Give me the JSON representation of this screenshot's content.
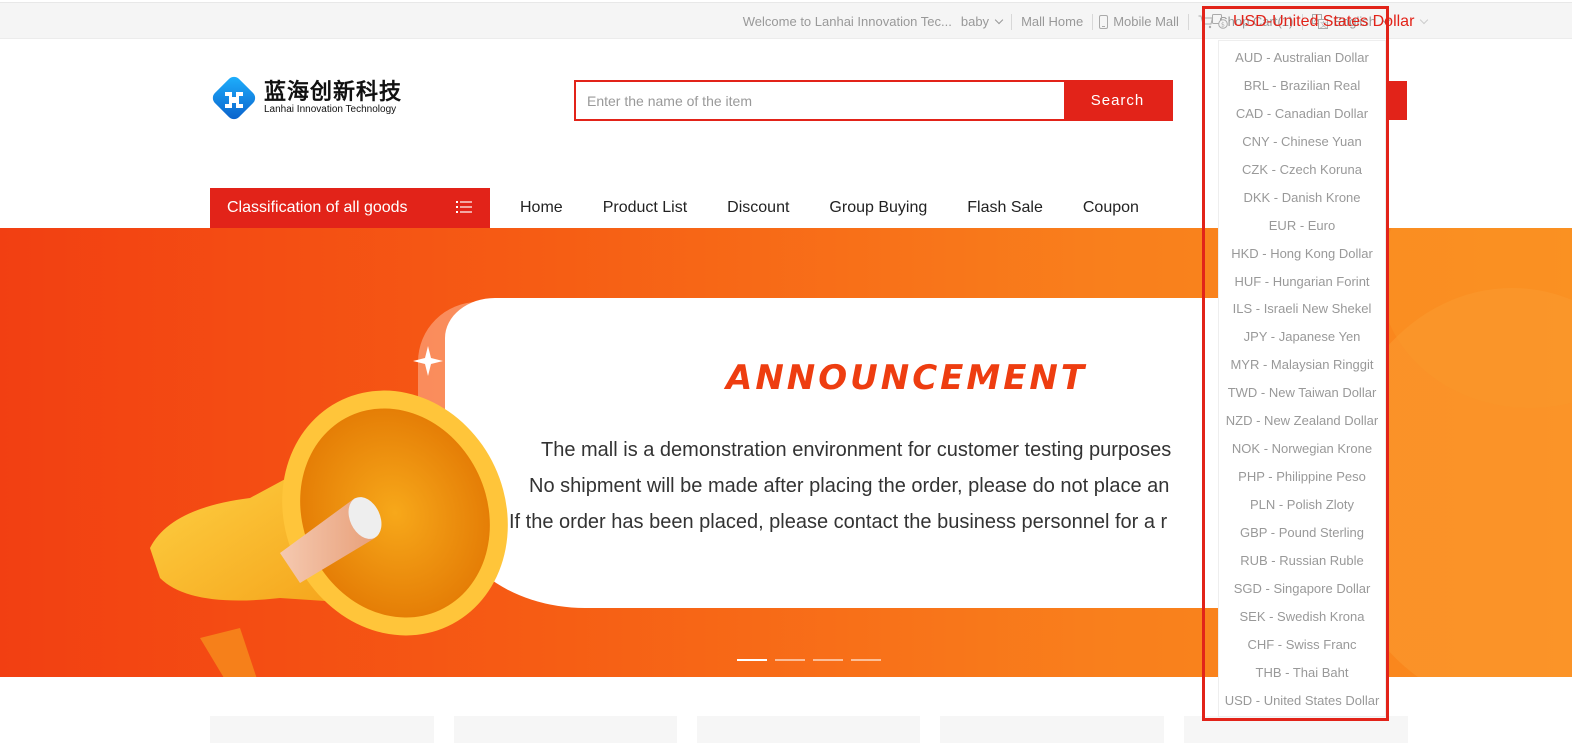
{
  "topbar": {
    "welcome": "Welcome to Lanhai Innovation Tec...",
    "user": "baby",
    "mall_home": "Mall Home",
    "mobile_mall": "Mobile Mall",
    "shop_cart": "Shop Cart(1)",
    "language": "English",
    "currency": "USD-United States Dollar",
    "icons": {
      "mobile": "mobile-phone-icon",
      "cart": "shopping-cart-icon",
      "language": "translate-icon",
      "currency": "currency-exchange-icon"
    }
  },
  "logo": {
    "cn": "蓝海创新科技",
    "en": "Lanhai Innovation Technology"
  },
  "search": {
    "placeholder": "Enter the name of the item",
    "button": "Search"
  },
  "nav": {
    "category": "Classification of all goods",
    "items": [
      "Home",
      "Product List",
      "Discount",
      "Group Buying",
      "Flash Sale",
      "Coupon"
    ]
  },
  "banner": {
    "title": "ANNOUNCEMENT",
    "lines": [
      "The mall is a demonstration environment for customer testing purposes",
      "No shipment will be made after placing the order, please do not place an",
      "If the order has been placed, please contact the business personnel for a r"
    ],
    "slides": 4,
    "active_slide": 1
  },
  "currency_options": [
    "AUD - Australian Dollar",
    "BRL - Brazilian Real",
    "CAD - Canadian Dollar",
    "CNY - Chinese Yuan",
    "CZK - Czech Koruna",
    "DKK - Danish Krone",
    "EUR - Euro",
    "HKD - Hong Kong Dollar",
    "HUF - Hungarian Forint",
    "ILS - Israeli New Shekel",
    "JPY - Japanese Yen",
    "MYR - Malaysian Ringgit",
    "TWD - New Taiwan Dollar",
    "NZD - New Zealand Dollar",
    "NOK - Norwegian Krone",
    "PHP - Philippine Peso",
    "PLN - Polish Zloty",
    "GBP - Pound Sterling",
    "RUB - Russian Ruble",
    "SGD - Singapore Dollar",
    "SEK - Swedish Krona",
    "CHF - Swiss Franc",
    "THB - Thai Baht",
    "USD - United States Dollar"
  ],
  "colors": {
    "brand_red": "#e22319",
    "banner_orange": "#f65d14"
  }
}
